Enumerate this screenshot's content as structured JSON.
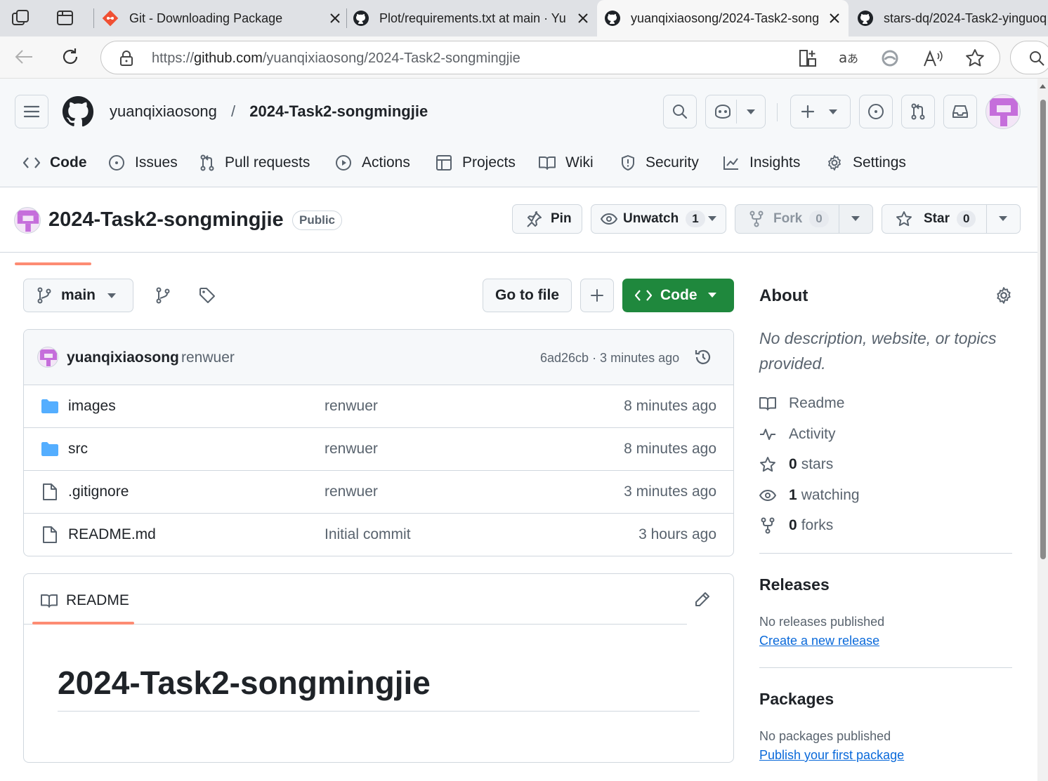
{
  "browser": {
    "tabs": [
      {
        "title": "Git - Downloading Package",
        "active": false
      },
      {
        "title": "Plot/requirements.txt at main · Yu",
        "active": false
      },
      {
        "title": "yuanqixiaosong/2024-Task2-song",
        "active": true
      },
      {
        "title": "stars-dq/2024-Task2-yinguoq",
        "active": false
      }
    ],
    "url_prefix": "https://",
    "url_host": "github.com",
    "url_path": "/yuanqixiaosong/2024-Task2-songmingjie"
  },
  "header": {
    "owner": "yuanqixiaosong",
    "separator": "/",
    "repo": "2024-Task2-songmingjie"
  },
  "repo_nav": [
    {
      "label": "Code",
      "icon": "code-icon",
      "selected": true
    },
    {
      "label": "Issues",
      "icon": "issue-icon"
    },
    {
      "label": "Pull requests",
      "icon": "pull-request-icon"
    },
    {
      "label": "Actions",
      "icon": "play-icon"
    },
    {
      "label": "Projects",
      "icon": "table-icon"
    },
    {
      "label": "Wiki",
      "icon": "book-icon"
    },
    {
      "label": "Security",
      "icon": "shield-icon"
    },
    {
      "label": "Insights",
      "icon": "graph-icon"
    },
    {
      "label": "Settings",
      "icon": "gear-icon"
    }
  ],
  "repo_title": {
    "name": "2024-Task2-songmingjie",
    "visibility": "Public",
    "pin": "Pin",
    "unwatch": "Unwatch",
    "watch_count": "1",
    "fork": "Fork",
    "fork_count": "0",
    "star": "Star",
    "star_count": "0"
  },
  "toolbar": {
    "branch": "main",
    "go_to_file": "Go to file",
    "code": "Code"
  },
  "commit": {
    "author": "yuanqixiaosong",
    "message": "renwuer",
    "hash_time": "6ad26cb · 3 minutes ago"
  },
  "files": [
    {
      "name": "images",
      "type": "folder",
      "message": "renwuer",
      "time": "8 minutes ago"
    },
    {
      "name": "src",
      "type": "folder",
      "message": "renwuer",
      "time": "8 minutes ago"
    },
    {
      "name": ".gitignore",
      "type": "file",
      "message": "renwuer",
      "time": "3 minutes ago"
    },
    {
      "name": "README.md",
      "type": "file",
      "message": "Initial commit",
      "time": "3 hours ago"
    }
  ],
  "readme": {
    "tab": "README",
    "heading": "2024-Task2-songmingjie"
  },
  "about": {
    "title": "About",
    "description": "No description, website, or topics provided.",
    "readme": "Readme",
    "activity": "Activity",
    "stars_count": "0",
    "stars_label": "stars",
    "watching_count": "1",
    "watching_label": "watching",
    "forks_count": "0",
    "forks_label": "forks"
  },
  "releases": {
    "title": "Releases",
    "empty": "No releases published",
    "link": "Create a new release"
  },
  "packages": {
    "title": "Packages",
    "empty": "No packages published",
    "link": "Publish your first package"
  },
  "colors": {
    "accent_underline": "#fd8c73",
    "primary_green": "#1f883d",
    "link_blue": "#0969da",
    "folder_blue": "#54aeff",
    "avatar_purple": "#c56edb"
  }
}
